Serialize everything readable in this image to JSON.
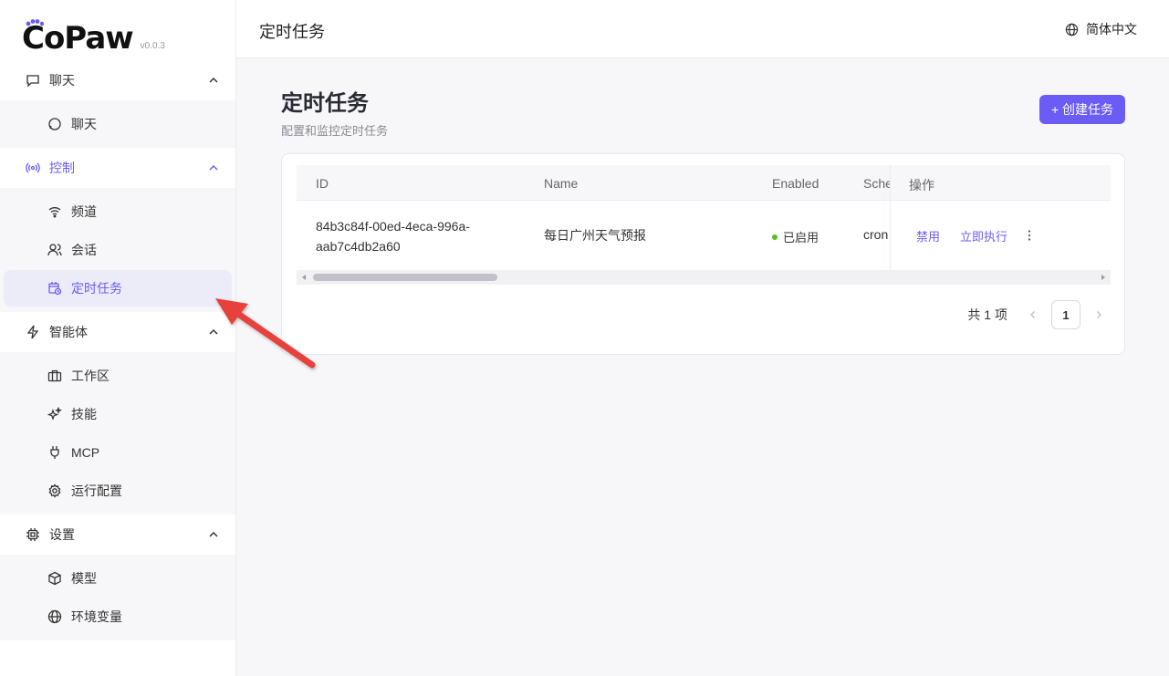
{
  "app": {
    "name": "CoPaw",
    "version": "v0.0.3"
  },
  "header": {
    "title": "定时任务",
    "language": "简体中文"
  },
  "sidebar": {
    "groups": [
      {
        "label": "聊天",
        "icon": "chat-bubble-icon",
        "items": [
          {
            "label": "聊天",
            "icon": "chat-icon"
          }
        ]
      },
      {
        "label": "控制",
        "icon": "broadcast-icon",
        "active": true,
        "items": [
          {
            "label": "频道",
            "icon": "wifi-icon"
          },
          {
            "label": "会话",
            "icon": "users-icon"
          },
          {
            "label": "定时任务",
            "icon": "calendar-clock-icon",
            "selected": true
          }
        ]
      },
      {
        "label": "智能体",
        "icon": "lightning-icon",
        "items": [
          {
            "label": "工作区",
            "icon": "briefcase-icon"
          },
          {
            "label": "技能",
            "icon": "sparkles-icon"
          },
          {
            "label": "MCP",
            "icon": "plug-icon"
          },
          {
            "label": "运行配置",
            "icon": "gear-icon"
          }
        ]
      },
      {
        "label": "设置",
        "icon": "chip-icon",
        "items": [
          {
            "label": "模型",
            "icon": "cube-icon"
          },
          {
            "label": "环境变量",
            "icon": "globe-icon"
          }
        ]
      }
    ]
  },
  "main": {
    "title": "定时任务",
    "subtitle": "配置和监控定时任务",
    "create_button": "+ 创建任务",
    "table": {
      "columns": [
        "ID",
        "Name",
        "Enabled",
        "Sche",
        "操作"
      ],
      "rows": [
        {
          "id_line1": "84b3c84f-00ed-4eca-996a-",
          "id_line2": "aab7c4db2a60",
          "name": "每日广州天气预报",
          "enabled": "已启用",
          "schedule": "cron",
          "actions": {
            "disable": "禁用",
            "run_now": "立即执行"
          }
        }
      ]
    },
    "pagination": {
      "total": "共 1 项",
      "current_page": "1"
    }
  },
  "colors": {
    "accent": "#6a5cf5",
    "enabled_dot": "#52c41a",
    "annotation_arrow": "#e8403a"
  }
}
